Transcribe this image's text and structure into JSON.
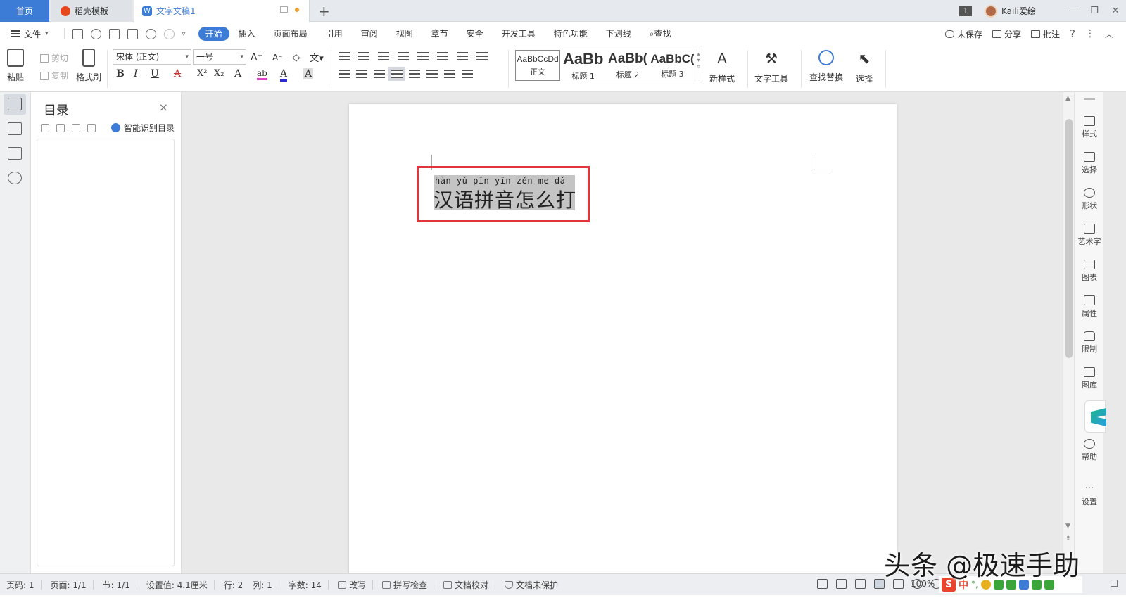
{
  "tabs": {
    "home": "首页",
    "template": "稻壳模板",
    "document": "文字文稿1",
    "add": "+"
  },
  "title_bar": {
    "window_count": "1",
    "username": "Kaili爱绘",
    "minimize": "—",
    "restore": "❐",
    "close": "✕"
  },
  "menu": {
    "file": "文件",
    "tabs": [
      "开始",
      "插入",
      "页面布局",
      "引用",
      "审阅",
      "视图",
      "章节",
      "安全",
      "开发工具",
      "特色功能",
      "下划线"
    ],
    "search": "查找",
    "right": {
      "unsaved": "未保存",
      "share": "分享",
      "comment": "批注",
      "help": "?",
      "more": "⋮",
      "collapse": "︿"
    }
  },
  "ribbon": {
    "paste": "粘贴",
    "cut": "剪切",
    "copy": "复制",
    "format_painter": "格式刷",
    "font_name": "宋体 (正文)",
    "font_size": "一号",
    "bold": "B",
    "italic": "I",
    "underline": "U",
    "strike": "A",
    "superscript": "X²",
    "subscript": "X₂",
    "styles": [
      {
        "sample": "AaBbCcDd",
        "name": "正文"
      },
      {
        "sample": "AaBb",
        "name": "标题 1"
      },
      {
        "sample": "AaBb(",
        "name": "标题 2"
      },
      {
        "sample": "AaBbC(",
        "name": "标题 3"
      }
    ],
    "new_style": "新样式",
    "text_tools": "文字工具",
    "find_replace": "查找替换",
    "select": "选择"
  },
  "toc": {
    "title": "目录",
    "close": "×",
    "smart": "智能识别目录"
  },
  "document": {
    "pinyin": "hàn yǔ pīn yīn zěn me dǎ",
    "text": "汉语拼音怎么打"
  },
  "right_panel": [
    {
      "label": "样式",
      "icon": "pen-icon"
    },
    {
      "label": "选择",
      "icon": "cursor-icon"
    },
    {
      "label": "形状",
      "icon": "shapes-icon"
    },
    {
      "label": "艺术字",
      "icon": "wordart-icon"
    },
    {
      "label": "图表",
      "icon": "chart-icon"
    },
    {
      "label": "属性",
      "icon": "sliders-icon"
    },
    {
      "label": "限制",
      "icon": "lock-icon"
    },
    {
      "label": "图库",
      "icon": "image-icon"
    },
    {
      "label": "帮助",
      "icon": "help-icon"
    },
    {
      "label": "设置",
      "icon": "ellipsis-icon"
    }
  ],
  "status": {
    "page_num": "页码: 1",
    "pages": "页面: 1/1",
    "section": "节: 1/1",
    "setting": "设置值: 4.1厘米",
    "row": "行: 2",
    "col": "列: 1",
    "word_count": "字数: 14",
    "revise": "改写",
    "spell_check": "拼写检查",
    "proofread": "文档校对",
    "protect": "文档未保护",
    "zoom": "100%",
    "ime_logo": "S",
    "ime_lang": "中"
  },
  "watermark": "头条 @极速手助"
}
